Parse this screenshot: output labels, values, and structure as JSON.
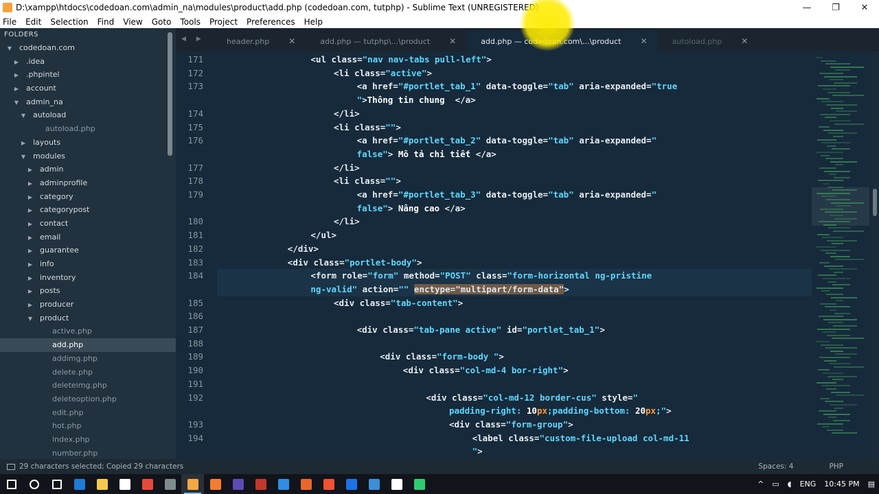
{
  "window": {
    "title": "D:\\xampp\\htdocs\\codedoan.com\\admin_na\\modules\\product\\add.php (codedoan.com, tutphp) - Sublime Text (UNREGISTERED)",
    "minimize": "—",
    "maximize": "❐",
    "close": "✕"
  },
  "menu": [
    "File",
    "Edit",
    "Selection",
    "Find",
    "View",
    "Goto",
    "Tools",
    "Project",
    "Preferences",
    "Help"
  ],
  "sidebar": {
    "header": "FOLDERS",
    "items": [
      {
        "label": "codedoan.com",
        "depth": 0,
        "arrow": "▼",
        "kind": "folder"
      },
      {
        "label": ".idea",
        "depth": 1,
        "arrow": "▶",
        "kind": "folder"
      },
      {
        "label": ".phpintel",
        "depth": 1,
        "arrow": "▶",
        "kind": "folder"
      },
      {
        "label": "account",
        "depth": 1,
        "arrow": "▶",
        "kind": "folder"
      },
      {
        "label": "admin_na",
        "depth": 1,
        "arrow": "▼",
        "kind": "folder"
      },
      {
        "label": "autoload",
        "depth": 2,
        "arrow": "▼",
        "kind": "folder"
      },
      {
        "label": "autoload.php",
        "depth": 3,
        "arrow": "",
        "kind": "file"
      },
      {
        "label": "layouts",
        "depth": 2,
        "arrow": "▶",
        "kind": "folder"
      },
      {
        "label": "modules",
        "depth": 2,
        "arrow": "▼",
        "kind": "folder"
      },
      {
        "label": "admin",
        "depth": 3,
        "arrow": "▶",
        "kind": "folder"
      },
      {
        "label": "adminprofile",
        "depth": 3,
        "arrow": "▶",
        "kind": "folder"
      },
      {
        "label": "category",
        "depth": 3,
        "arrow": "▶",
        "kind": "folder"
      },
      {
        "label": "categorypost",
        "depth": 3,
        "arrow": "▶",
        "kind": "folder"
      },
      {
        "label": "contact",
        "depth": 3,
        "arrow": "▶",
        "kind": "folder"
      },
      {
        "label": "email",
        "depth": 3,
        "arrow": "▶",
        "kind": "folder"
      },
      {
        "label": "guarantee",
        "depth": 3,
        "arrow": "▶",
        "kind": "folder"
      },
      {
        "label": "info",
        "depth": 3,
        "arrow": "▶",
        "kind": "folder"
      },
      {
        "label": "inventory",
        "depth": 3,
        "arrow": "▶",
        "kind": "folder"
      },
      {
        "label": "posts",
        "depth": 3,
        "arrow": "▶",
        "kind": "folder"
      },
      {
        "label": "producer",
        "depth": 3,
        "arrow": "▶",
        "kind": "folder"
      },
      {
        "label": "product",
        "depth": 3,
        "arrow": "▼",
        "kind": "folder"
      },
      {
        "label": "active.php",
        "depth": 4,
        "arrow": "",
        "kind": "file"
      },
      {
        "label": "add.php",
        "depth": 4,
        "arrow": "",
        "kind": "file",
        "selected": true
      },
      {
        "label": "addimg.php",
        "depth": 4,
        "arrow": "",
        "kind": "file"
      },
      {
        "label": "delete.php",
        "depth": 4,
        "arrow": "",
        "kind": "file"
      },
      {
        "label": "deleteimg.php",
        "depth": 4,
        "arrow": "",
        "kind": "file"
      },
      {
        "label": "deleteoption.php",
        "depth": 4,
        "arrow": "",
        "kind": "file"
      },
      {
        "label": "edit.php",
        "depth": 4,
        "arrow": "",
        "kind": "file"
      },
      {
        "label": "hot.php",
        "depth": 4,
        "arrow": "",
        "kind": "file"
      },
      {
        "label": "index.php",
        "depth": 4,
        "arrow": "",
        "kind": "file"
      },
      {
        "label": "number.php",
        "depth": 4,
        "arrow": "",
        "kind": "file"
      }
    ]
  },
  "tabs": [
    {
      "label": "header.php",
      "active": false
    },
    {
      "label": "add.php — tutphp\\...\\product",
      "active": false
    },
    {
      "label": "add.php — codedoan.com\\...\\product",
      "active": true
    },
    {
      "label": "autoload.php",
      "active": false,
      "dim": true
    }
  ],
  "tab_close": "✕",
  "tab_nav": "◀ ▶",
  "editor": {
    "lines": [
      {
        "num": "171",
        "indent": 8,
        "html": [
          [
            "tg",
            "<ul "
          ],
          [
            "at",
            "class="
          ],
          [
            "sv",
            "\"nav nav-tabs pull-left\""
          ],
          [
            "tg",
            ">"
          ]
        ]
      },
      {
        "num": "172",
        "indent": 10,
        "html": [
          [
            "tg",
            "<li "
          ],
          [
            "at",
            "class="
          ],
          [
            "sv",
            "\"active\""
          ],
          [
            "tg",
            ">"
          ]
        ]
      },
      {
        "num": "173",
        "indent": 12,
        "html": [
          [
            "tg",
            "<a "
          ],
          [
            "at",
            "href="
          ],
          [
            "sv",
            "\"#portlet_tab_1\""
          ],
          [
            "at",
            " data-toggle="
          ],
          [
            "sv",
            "\"tab\""
          ],
          [
            "at",
            " aria-expanded="
          ],
          [
            "sv",
            "\"true"
          ]
        ]
      },
      {
        "num": "",
        "indent": 12,
        "html": [
          [
            "sv",
            "\""
          ],
          [
            "tg",
            ">"
          ],
          [
            "tx",
            "Thông tin chung  "
          ],
          [
            "tg",
            "</a>"
          ]
        ]
      },
      {
        "num": "174",
        "indent": 10,
        "html": [
          [
            "tg",
            "</li>"
          ]
        ]
      },
      {
        "num": "175",
        "indent": 10,
        "html": [
          [
            "tg",
            "<li "
          ],
          [
            "at",
            "class="
          ],
          [
            "sv",
            "\"\""
          ],
          [
            "tg",
            ">"
          ]
        ]
      },
      {
        "num": "176",
        "indent": 12,
        "html": [
          [
            "tg",
            "<a "
          ],
          [
            "at",
            "href="
          ],
          [
            "sv",
            "\"#portlet_tab_2\""
          ],
          [
            "at",
            " data-toggle="
          ],
          [
            "sv",
            "\"tab\""
          ],
          [
            "at",
            " aria-expanded="
          ],
          [
            "sv",
            "\""
          ]
        ]
      },
      {
        "num": "",
        "indent": 12,
        "html": [
          [
            "sv",
            "false\""
          ],
          [
            "tg",
            "> "
          ],
          [
            "tx",
            "Mô tả chi tiết "
          ],
          [
            "tg",
            "</a>"
          ]
        ]
      },
      {
        "num": "177",
        "indent": 10,
        "html": [
          [
            "tg",
            "</li>"
          ]
        ]
      },
      {
        "num": "178",
        "indent": 10,
        "html": [
          [
            "tg",
            "<li "
          ],
          [
            "at",
            "class="
          ],
          [
            "sv",
            "\"\""
          ],
          [
            "tg",
            ">"
          ]
        ]
      },
      {
        "num": "179",
        "indent": 12,
        "html": [
          [
            "tg",
            "<a "
          ],
          [
            "at",
            "href="
          ],
          [
            "sv",
            "\"#portlet_tab_3\""
          ],
          [
            "at",
            " data-toggle="
          ],
          [
            "sv",
            "\"tab\""
          ],
          [
            "at",
            " aria-expanded="
          ],
          [
            "sv",
            "\""
          ]
        ]
      },
      {
        "num": "",
        "indent": 12,
        "html": [
          [
            "sv",
            "false\""
          ],
          [
            "tg",
            "> "
          ],
          [
            "tx",
            "Nâng cao "
          ],
          [
            "tg",
            "</a>"
          ]
        ]
      },
      {
        "num": "180",
        "indent": 10,
        "html": [
          [
            "tg",
            "</li>"
          ]
        ]
      },
      {
        "num": "181",
        "indent": 8,
        "html": [
          [
            "tg",
            "</ul>"
          ]
        ]
      },
      {
        "num": "182",
        "indent": 6,
        "html": [
          [
            "tg",
            "</div>"
          ]
        ]
      },
      {
        "num": "183",
        "indent": 6,
        "html": [
          [
            "tg",
            "<div "
          ],
          [
            "at",
            "class="
          ],
          [
            "sv",
            "\"portlet-body\""
          ],
          [
            "tg",
            ">"
          ]
        ]
      },
      {
        "num": "184",
        "indent": 8,
        "html": [
          [
            "tg",
            "<form "
          ],
          [
            "at",
            "role="
          ],
          [
            "sv",
            "\"form\""
          ],
          [
            "at",
            " method="
          ],
          [
            "sv",
            "\"POST\""
          ],
          [
            "at",
            " class="
          ],
          [
            "sv",
            "\"form-horizontal ng-pristine"
          ]
        ]
      },
      {
        "num": "",
        "indent": 8,
        "html": [
          [
            "sv",
            "ng-valid\""
          ],
          [
            "at",
            " action="
          ],
          [
            "sv",
            "\"\" "
          ],
          [
            "sel",
            "enctype=\"multipart/form-data\""
          ],
          [
            "tg",
            ">"
          ]
        ]
      },
      {
        "num": "185",
        "indent": 10,
        "html": [
          [
            "tg",
            "<div "
          ],
          [
            "at",
            "class="
          ],
          [
            "sv",
            "\"tab-content\""
          ],
          [
            "tg",
            ">"
          ]
        ]
      },
      {
        "num": "186",
        "indent": 0,
        "html": []
      },
      {
        "num": "187",
        "indent": 12,
        "html": [
          [
            "tg",
            "<div "
          ],
          [
            "at",
            "class="
          ],
          [
            "sv",
            "\"tab-pane active\""
          ],
          [
            "at",
            " id="
          ],
          [
            "sv",
            "\"portlet_tab_1\""
          ],
          [
            "tg",
            ">"
          ]
        ]
      },
      {
        "num": "188",
        "indent": 0,
        "html": []
      },
      {
        "num": "189",
        "indent": 14,
        "html": [
          [
            "tg",
            "<div "
          ],
          [
            "at",
            "class="
          ],
          [
            "sv",
            "\"form-body \""
          ],
          [
            "tg",
            ">"
          ]
        ]
      },
      {
        "num": "190",
        "indent": 16,
        "html": [
          [
            "tg",
            "<div "
          ],
          [
            "at",
            "class="
          ],
          [
            "sv",
            "\"col-md-4 bor-right\""
          ],
          [
            "tg",
            ">"
          ]
        ]
      },
      {
        "num": "191",
        "indent": 0,
        "html": []
      },
      {
        "num": "192",
        "indent": 18,
        "html": [
          [
            "tg",
            "<div "
          ],
          [
            "at",
            "class="
          ],
          [
            "sv",
            "\"col-md-12 border-cus\""
          ],
          [
            "at",
            " style="
          ],
          [
            "sv",
            "\""
          ]
        ]
      },
      {
        "num": "",
        "indent": 20,
        "html": [
          [
            "sv",
            "padding-right: "
          ],
          [
            "tx",
            "10"
          ],
          [
            "bm",
            "px"
          ],
          [
            "sv",
            ";padding-bottom: "
          ],
          [
            "tx",
            "20"
          ],
          [
            "bm",
            "px"
          ],
          [
            "sv",
            ";\""
          ],
          [
            "tg",
            ">"
          ]
        ]
      },
      {
        "num": "193",
        "indent": 20,
        "html": [
          [
            "tg",
            "<div "
          ],
          [
            "at",
            "class="
          ],
          [
            "sv",
            "\"form-group\""
          ],
          [
            "tg",
            ">"
          ]
        ]
      },
      {
        "num": "194",
        "indent": 22,
        "html": [
          [
            "tg",
            "<label "
          ],
          [
            "at",
            "class="
          ],
          [
            "sv",
            "\"custom-file-upload col-md-11"
          ]
        ]
      },
      {
        "num": "",
        "indent": 22,
        "html": [
          [
            "sv",
            "\""
          ],
          [
            "tg",
            ">"
          ]
        ]
      }
    ]
  },
  "status": {
    "left": "29 characters selected; Copied 29 characters",
    "spaces": "Spaces: 4",
    "syntax": "PHP"
  },
  "taskbar": {
    "lang": "ENG",
    "time": "10:45 PM",
    "icons": [
      "windows-start-icon",
      "cortana-icon",
      "task-view-icon",
      "edge-icon",
      "file-explorer-icon",
      "store-icon",
      "chrome-icon",
      "settings-icon",
      "sublime-text-icon",
      "xampp-icon",
      "visual-studio-icon",
      "filezilla-icon",
      "app-blue-icon",
      "firefox-icon",
      "git-icon",
      "teamviewer-icon",
      "mail-icon",
      "notepad-icon",
      "cmd-icon"
    ]
  }
}
